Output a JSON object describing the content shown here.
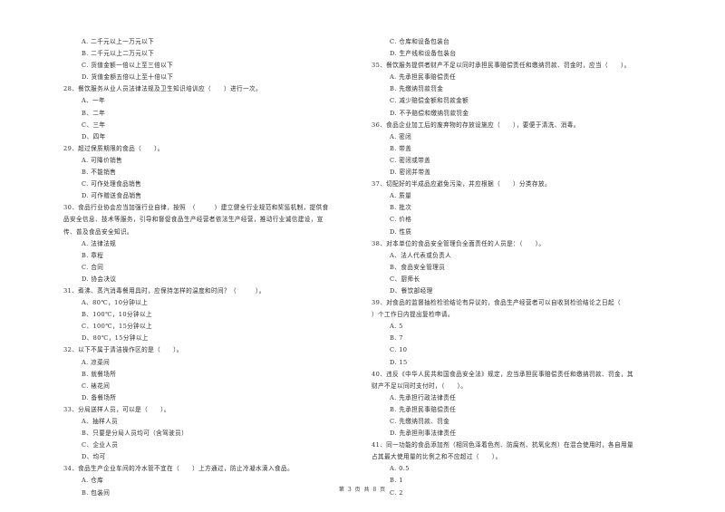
{
  "page": {
    "footer": "第 3 页 共 8 页"
  },
  "left": [
    {
      "type": "opt",
      "text": "A. 二千元以上一万元以下"
    },
    {
      "type": "opt",
      "text": "B. 二千元以上二万元以下"
    },
    {
      "type": "opt",
      "text": "C. 货值金额一倍以上至三倍以下"
    },
    {
      "type": "opt",
      "text": "D. 货值金额五倍以上至十倍以下"
    },
    {
      "type": "q",
      "text": "28、餐饮服务从业人员法律法规及卫生知识培训应（　　）进行一次。"
    },
    {
      "type": "opt",
      "text": "A、一年"
    },
    {
      "type": "opt",
      "text": "B、二年"
    },
    {
      "type": "opt",
      "text": "C、三年"
    },
    {
      "type": "opt",
      "text": "D、四年"
    },
    {
      "type": "q",
      "text": "29、超过保质期限的食品（　　）。"
    },
    {
      "type": "opt",
      "text": "A. 可降价销售"
    },
    {
      "type": "opt",
      "text": "B. 不能销售"
    },
    {
      "type": "opt",
      "text": "C. 可作处理食品销售"
    },
    {
      "type": "opt",
      "text": "D. 可作赠送食品销售"
    },
    {
      "type": "q",
      "text": "30、食品行业协会应当加强行业自律，按照　（　　　）建立健全行业规范和奖惩机制，提供食"
    },
    {
      "type": "q",
      "text": "品安全信息、技术等服务，引导和督促食品生产经营者依法生产经营，推动行业诚信建设，宣"
    },
    {
      "type": "q",
      "text": "传、普及食品安全知识。"
    },
    {
      "type": "opt",
      "text": "A. 法律法规"
    },
    {
      "type": "opt",
      "text": "B. 章程"
    },
    {
      "type": "opt",
      "text": "C. 合同"
    },
    {
      "type": "opt",
      "text": "D. 协会决议"
    },
    {
      "type": "q",
      "text": "31、煮沸、蒸汽消毒餐用具时，应保持怎样的温度和时间？（　　　）。"
    },
    {
      "type": "opt",
      "text": "A、80℃，10分钟以上"
    },
    {
      "type": "opt",
      "text": "B、100℃，10分钟以上"
    },
    {
      "type": "opt",
      "text": "C、100℃，15分钟以上"
    },
    {
      "type": "opt",
      "text": "D、80℃，15分钟以上"
    },
    {
      "type": "q",
      "text": "32、以下不属于清洁操作区的是（　　）。"
    },
    {
      "type": "opt",
      "text": "A. 凉菜间"
    },
    {
      "type": "opt",
      "text": "B. 就餐场所"
    },
    {
      "type": "opt",
      "text": "C. 裱花间"
    },
    {
      "type": "opt",
      "text": "D. 备餐场所"
    },
    {
      "type": "q",
      "text": "33、分局送样人员，可以是（　　）。"
    },
    {
      "type": "opt",
      "text": "A、抽样人员"
    },
    {
      "type": "opt",
      "text": "B、只要是分局人员均可（含驾驶员）"
    },
    {
      "type": "opt",
      "text": "C、企业人员"
    },
    {
      "type": "opt",
      "text": "D、均可"
    },
    {
      "type": "q",
      "text": "34、食品生产企业车间的冷水管不宜在（　　）上方通过，防止冷凝水滴入食品。"
    },
    {
      "type": "opt",
      "text": "A. 仓库"
    },
    {
      "type": "opt",
      "text": "B. 包装间"
    }
  ],
  "right": [
    {
      "type": "opt",
      "text": "C. 仓库和设备包装台"
    },
    {
      "type": "opt",
      "text": "D. 生产线和设备包装台"
    },
    {
      "type": "q",
      "text": "35、餐饮服务提供者财产不足以同时承担民事赔偿责任和缴纳罚款、罚金时，应当（　　）。"
    },
    {
      "type": "opt",
      "text": "A. 先承担民事赔偿责任"
    },
    {
      "type": "opt",
      "text": "B. 先缴纳罚款罚金"
    },
    {
      "type": "opt",
      "text": "C. 减少赔偿金额和罚款金额"
    },
    {
      "type": "opt",
      "text": "D. 不予赔偿和缴纳罚款罚金"
    },
    {
      "type": "q",
      "text": "36、食品企业加工后的废弃物的存放设施应（　　），要便于清洗、消毒。"
    },
    {
      "type": "opt",
      "text": "A. 密闭"
    },
    {
      "type": "opt",
      "text": "B. 带盖"
    },
    {
      "type": "opt",
      "text": "C. 密闭或带盖"
    },
    {
      "type": "opt",
      "text": "D. 密闭并带盖"
    },
    {
      "type": "q",
      "text": "37、切配好的半成品应避免污染，并应根据（　　）分类存放。"
    },
    {
      "type": "opt",
      "text": "A. 质量"
    },
    {
      "type": "opt",
      "text": "B. 批次"
    },
    {
      "type": "opt",
      "text": "C. 价格"
    },
    {
      "type": "opt",
      "text": "D. 性质"
    },
    {
      "type": "q",
      "text": "38、对本单位的食品安全管理负全面责任的人员是：（　　）。"
    },
    {
      "type": "opt",
      "text": "A、法人代表或负责人"
    },
    {
      "type": "opt",
      "text": "B、食品安全管理员"
    },
    {
      "type": "opt",
      "text": "C、厨师长"
    },
    {
      "type": "opt",
      "text": "D、餐饮部经理"
    },
    {
      "type": "q",
      "text": "39、对食品的监督抽检检验结论有异议的，食品生产经营者可以自收到检验结论之日起（"
    },
    {
      "type": "q",
      "text": "）个工作日内提出复检申请。"
    },
    {
      "type": "opt",
      "text": "A. 5"
    },
    {
      "type": "opt",
      "text": "B. 7"
    },
    {
      "type": "opt",
      "text": "C. 10"
    },
    {
      "type": "opt",
      "text": "D. 15"
    },
    {
      "type": "q",
      "text": "40、违反《中华人民共和国食品安全法》规定，应当承担民事赔偿责任和缴纳罚款、罚金，其"
    },
    {
      "type": "q",
      "text": "财产不足以同时支付时，（　　）。"
    },
    {
      "type": "opt",
      "text": "A. 先承担行政法律责任"
    },
    {
      "type": "opt",
      "text": "B. 先承担民事赔偿责任"
    },
    {
      "type": "opt",
      "text": "C. 先缴纳罚款、罚金"
    },
    {
      "type": "opt",
      "text": "D. 先承担刑事法律责任"
    },
    {
      "type": "q",
      "text": "41、同一功能的食品添加剂（相同色泽着色剂、防腐剂、抗氧化剂）在混合使用时，各自用量"
    },
    {
      "type": "q",
      "text": "占其最大使用量的比例之和不应超过（　　）。"
    },
    {
      "type": "opt",
      "text": "A. 0.5"
    },
    {
      "type": "opt",
      "text": "B. 1"
    },
    {
      "type": "opt",
      "text": "C. 2"
    }
  ]
}
